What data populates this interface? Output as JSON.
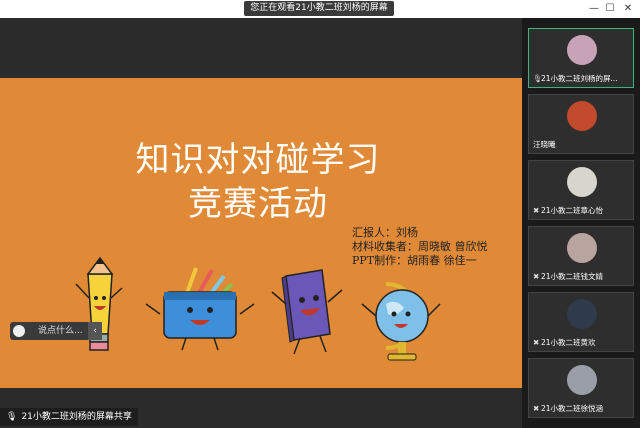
{
  "window": {
    "title": "您正在观看21小教二班刘杨的屏幕",
    "minimize": "—",
    "maximize": "☐",
    "close": "✕"
  },
  "slide": {
    "title_line1": "知识对对碰学习",
    "title_line2": "竞赛活动",
    "credits": [
      "汇报人：刘杨",
      "材料收集者：周晓敏  曾欣悦",
      "PPT制作：胡雨春  徐佳一"
    ]
  },
  "chat": {
    "placeholder": "说点什么...",
    "collapse": "‹"
  },
  "share_label": "21小教二班刘杨的屏幕共享",
  "participants": [
    {
      "name": "21小教二班刘杨的屏...",
      "avatar_color": "#c7a3b8",
      "active": true
    },
    {
      "name": "汪晓曦",
      "avatar_color": "#c34a2c",
      "active": false
    },
    {
      "name": "21小教二班章心怡",
      "avatar_color": "#d6d6cc",
      "active": false
    },
    {
      "name": "21小教二班钱文婧",
      "avatar_color": "#b9a5a0",
      "active": false
    },
    {
      "name": "21小教二班黄欢",
      "avatar_color": "#2f3a4a",
      "active": false
    },
    {
      "name": "21小教二班徐悦涵",
      "avatar_color": "#9a9ea8",
      "active": false
    }
  ]
}
